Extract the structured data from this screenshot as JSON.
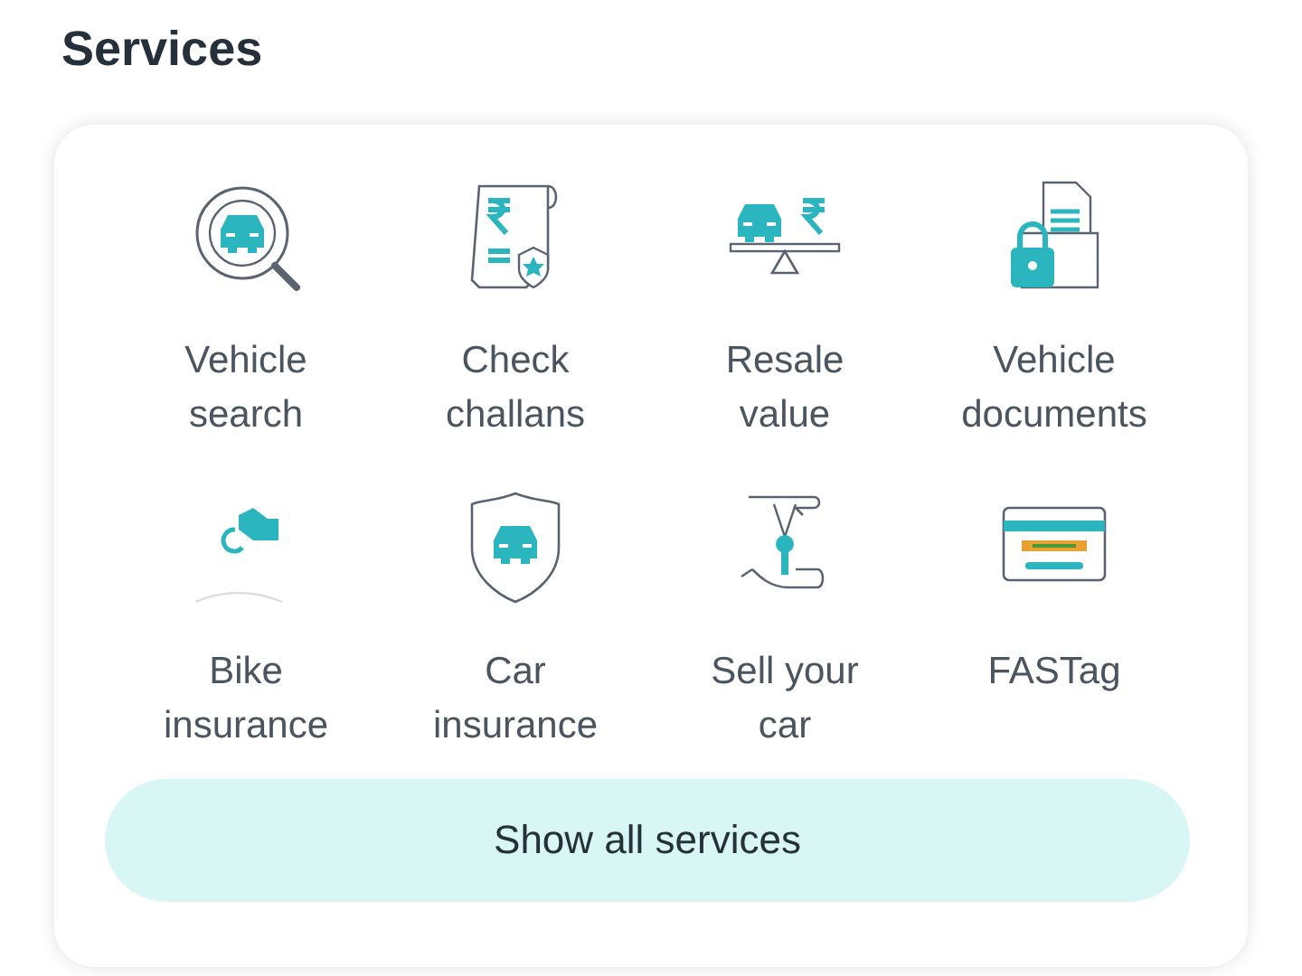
{
  "heading": "Services",
  "services": [
    {
      "kind": "vehicle-search",
      "label": "Vehicle search"
    },
    {
      "kind": "challan",
      "label": "Check challans"
    },
    {
      "kind": "resale",
      "label": "Resale value"
    },
    {
      "kind": "documents",
      "label": "Vehicle documents"
    },
    {
      "kind": "bike",
      "label": "Bike insurance"
    },
    {
      "kind": "car-insurance",
      "label": "Car insurance"
    },
    {
      "kind": "sell",
      "label": "Sell your car"
    },
    {
      "kind": "fastag",
      "label": "FASTag"
    }
  ],
  "button": "Show all services"
}
